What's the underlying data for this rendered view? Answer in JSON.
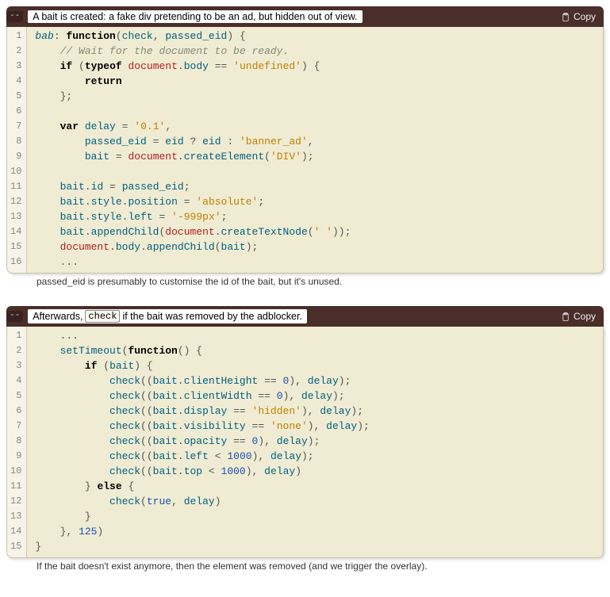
{
  "blocks": [
    {
      "caption_pre": "A bait is created: a fake div pretending to be an ad, but hidden out of view.",
      "caption_code": null,
      "caption_post": null,
      "copy_label": "Copy",
      "collapse_label": "--",
      "footnote": "passed_eid is presumably to customise the id of the bait, but it's unused.",
      "code": {
        "lines": [
          {
            "n": 1,
            "html": "<span class='c-fn'>bab</span><span class='c-punct'>:</span> <span class='c-kw'>function</span><span class='c-punct'>(</span><span class='c-ident'>check</span><span class='c-punct'>,</span> <span class='c-ident'>passed_eid</span><span class='c-punct'>)</span> <span class='c-punct'>{</span>"
          },
          {
            "n": 2,
            "html": "    <span class='c-com'>// Wait for the document to be ready.</span>"
          },
          {
            "n": 3,
            "html": "    <span class='c-kw'>if</span> <span class='c-punct'>(</span><span class='c-kw'>typeof</span> <span class='c-red'>document</span><span class='c-punct'>.</span><span class='c-ident'>body</span> <span class='c-op'>==</span> <span class='c-str'>'undefined'</span><span class='c-punct'>)</span> <span class='c-punct'>{</span>"
          },
          {
            "n": 4,
            "html": "        <span class='c-kw'>return</span>"
          },
          {
            "n": 5,
            "html": "    <span class='c-punct'>};</span>"
          },
          {
            "n": 6,
            "html": ""
          },
          {
            "n": 7,
            "html": "    <span class='c-kw'>var</span> <span class='c-ident'>delay</span> <span class='c-op'>=</span> <span class='c-str'>'0.1'</span><span class='c-punct'>,</span>"
          },
          {
            "n": 8,
            "html": "        <span class='c-ident'>passed_eid</span> <span class='c-op'>=</span> <span class='c-ident'>eid</span> <span class='c-op'>?</span> <span class='c-ident'>eid</span> <span class='c-op'>:</span> <span class='c-str'>'banner_ad'</span><span class='c-punct'>,</span>"
          },
          {
            "n": 9,
            "html": "        <span class='c-ident'>bait</span> <span class='c-op'>=</span> <span class='c-red'>document</span><span class='c-punct'>.</span><span class='c-ident'>createElement</span><span class='c-punct'>(</span><span class='c-str'>'DIV'</span><span class='c-punct'>);</span>"
          },
          {
            "n": 10,
            "html": ""
          },
          {
            "n": 11,
            "html": "    <span class='c-ident'>bait</span><span class='c-punct'>.</span><span class='c-ident'>id</span> <span class='c-op'>=</span> <span class='c-ident'>passed_eid</span><span class='c-punct'>;</span>"
          },
          {
            "n": 12,
            "html": "    <span class='c-ident'>bait</span><span class='c-punct'>.</span><span class='c-ident'>style</span><span class='c-punct'>.</span><span class='c-ident'>position</span> <span class='c-op'>=</span> <span class='c-str'>'absolute'</span><span class='c-punct'>;</span>"
          },
          {
            "n": 13,
            "html": "    <span class='c-ident'>bait</span><span class='c-punct'>.</span><span class='c-ident'>style</span><span class='c-punct'>.</span><span class='c-ident'>left</span> <span class='c-op'>=</span> <span class='c-str'>'-999px'</span><span class='c-punct'>;</span>"
          },
          {
            "n": 14,
            "html": "    <span class='c-ident'>bait</span><span class='c-punct'>.</span><span class='c-ident'>appendChild</span><span class='c-punct'>(</span><span class='c-red'>document</span><span class='c-punct'>.</span><span class='c-ident'>createTextNode</span><span class='c-punct'>(</span><span class='c-str'>' '</span><span class='c-punct'>));</span>"
          },
          {
            "n": 15,
            "html": "    <span class='c-red'>document</span><span class='c-punct'>.</span><span class='c-ident'>body</span><span class='c-punct'>.</span><span class='c-ident'>appendChild</span><span class='c-punct'>(</span><span class='c-ident'>bait</span><span class='c-punct'>);</span>"
          },
          {
            "n": 16,
            "html": "    <span class='c-punct'>...</span>"
          }
        ]
      }
    },
    {
      "caption_pre": "Afterwards, ",
      "caption_code": "check",
      "caption_post": " if the bait was removed by the adblocker.",
      "copy_label": "Copy",
      "collapse_label": "--",
      "footnote": "If the bait doesn't exist anymore, then the element was removed (and we trigger the overlay).",
      "code": {
        "lines": [
          {
            "n": 1,
            "html": "    <span class='c-punct'>...</span>"
          },
          {
            "n": 2,
            "html": "    <span class='c-ident'>setTimeout</span><span class='c-punct'>(</span><span class='c-kw'>function</span><span class='c-punct'>()</span> <span class='c-punct'>{</span>"
          },
          {
            "n": 3,
            "html": "        <span class='c-kw'>if</span> <span class='c-punct'>(</span><span class='c-ident'>bait</span><span class='c-punct'>)</span> <span class='c-punct'>{</span>"
          },
          {
            "n": 4,
            "html": "            <span class='c-ident'>check</span><span class='c-punct'>((</span><span class='c-ident'>bait</span><span class='c-punct'>.</span><span class='c-ident'>clientHeight</span> <span class='c-op'>==</span> <span class='c-num'>0</span><span class='c-punct'>),</span> <span class='c-ident'>delay</span><span class='c-punct'>);</span>"
          },
          {
            "n": 5,
            "html": "            <span class='c-ident'>check</span><span class='c-punct'>((</span><span class='c-ident'>bait</span><span class='c-punct'>.</span><span class='c-ident'>clientWidth</span> <span class='c-op'>==</span> <span class='c-num'>0</span><span class='c-punct'>),</span> <span class='c-ident'>delay</span><span class='c-punct'>);</span>"
          },
          {
            "n": 6,
            "html": "            <span class='c-ident'>check</span><span class='c-punct'>((</span><span class='c-ident'>bait</span><span class='c-punct'>.</span><span class='c-ident'>display</span> <span class='c-op'>==</span> <span class='c-str'>'hidden'</span><span class='c-punct'>),</span> <span class='c-ident'>delay</span><span class='c-punct'>);</span>"
          },
          {
            "n": 7,
            "html": "            <span class='c-ident'>check</span><span class='c-punct'>((</span><span class='c-ident'>bait</span><span class='c-punct'>.</span><span class='c-ident'>visibility</span> <span class='c-op'>==</span> <span class='c-str'>'none'</span><span class='c-punct'>),</span> <span class='c-ident'>delay</span><span class='c-punct'>);</span>"
          },
          {
            "n": 8,
            "html": "            <span class='c-ident'>check</span><span class='c-punct'>((</span><span class='c-ident'>bait</span><span class='c-punct'>.</span><span class='c-ident'>opacity</span> <span class='c-op'>==</span> <span class='c-num'>0</span><span class='c-punct'>),</span> <span class='c-ident'>delay</span><span class='c-punct'>);</span>"
          },
          {
            "n": 9,
            "html": "            <span class='c-ident'>check</span><span class='c-punct'>((</span><span class='c-ident'>bait</span><span class='c-punct'>.</span><span class='c-ident'>left</span> <span class='c-op'>&lt;</span> <span class='c-num'>1000</span><span class='c-punct'>),</span> <span class='c-ident'>delay</span><span class='c-punct'>);</span>"
          },
          {
            "n": 10,
            "html": "            <span class='c-ident'>check</span><span class='c-punct'>((</span><span class='c-ident'>bait</span><span class='c-punct'>.</span><span class='c-ident'>top</span> <span class='c-op'>&lt;</span> <span class='c-num'>1000</span><span class='c-punct'>),</span> <span class='c-ident'>delay</span><span class='c-punct'>)</span>"
          },
          {
            "n": 11,
            "html": "        <span class='c-punct'>}</span> <span class='c-kw'>else</span> <span class='c-punct'>{</span>"
          },
          {
            "n": 12,
            "html": "            <span class='c-ident'>check</span><span class='c-punct'>(</span><span class='c-bool'>true</span><span class='c-punct'>,</span> <span class='c-ident'>delay</span><span class='c-punct'>)</span>"
          },
          {
            "n": 13,
            "html": "        <span class='c-punct'>}</span>"
          },
          {
            "n": 14,
            "html": "    <span class='c-punct'>},</span> <span class='c-num'>125</span><span class='c-punct'>)</span>"
          },
          {
            "n": 15,
            "html": "<span class='c-punct'>}</span>"
          }
        ]
      }
    }
  ]
}
